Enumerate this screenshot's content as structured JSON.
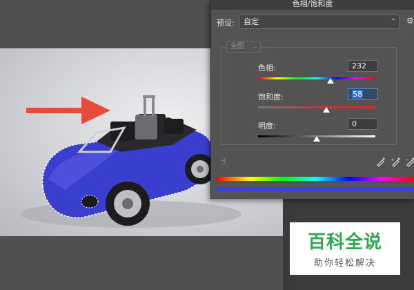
{
  "dialog": {
    "title": "色相/饱和度",
    "preset_label": "预设:",
    "preset_value": "自定",
    "channel_value": "全图"
  },
  "sliders": {
    "hue": {
      "label": "色相:",
      "value": "232",
      "fraction": 0.62
    },
    "saturation": {
      "label": "饱和度:",
      "value": "58",
      "fraction": 0.58
    },
    "lightness": {
      "label": "明度:",
      "value": "0",
      "fraction": 0.5
    }
  },
  "icons": {
    "settings": "gear-icon",
    "target_adjust": "hand-icon",
    "eyedroppers": [
      "eyedropper-icon",
      "eyedropper-plus-icon",
      "eyedropper-minus-icon"
    ]
  },
  "watermark": {
    "title": "百科全说",
    "subtitle": "助你轻松解决"
  },
  "colors": {
    "arrow": "#e84b3a",
    "car": "#3a3ecf",
    "watermark_green": "#2fa84d"
  }
}
